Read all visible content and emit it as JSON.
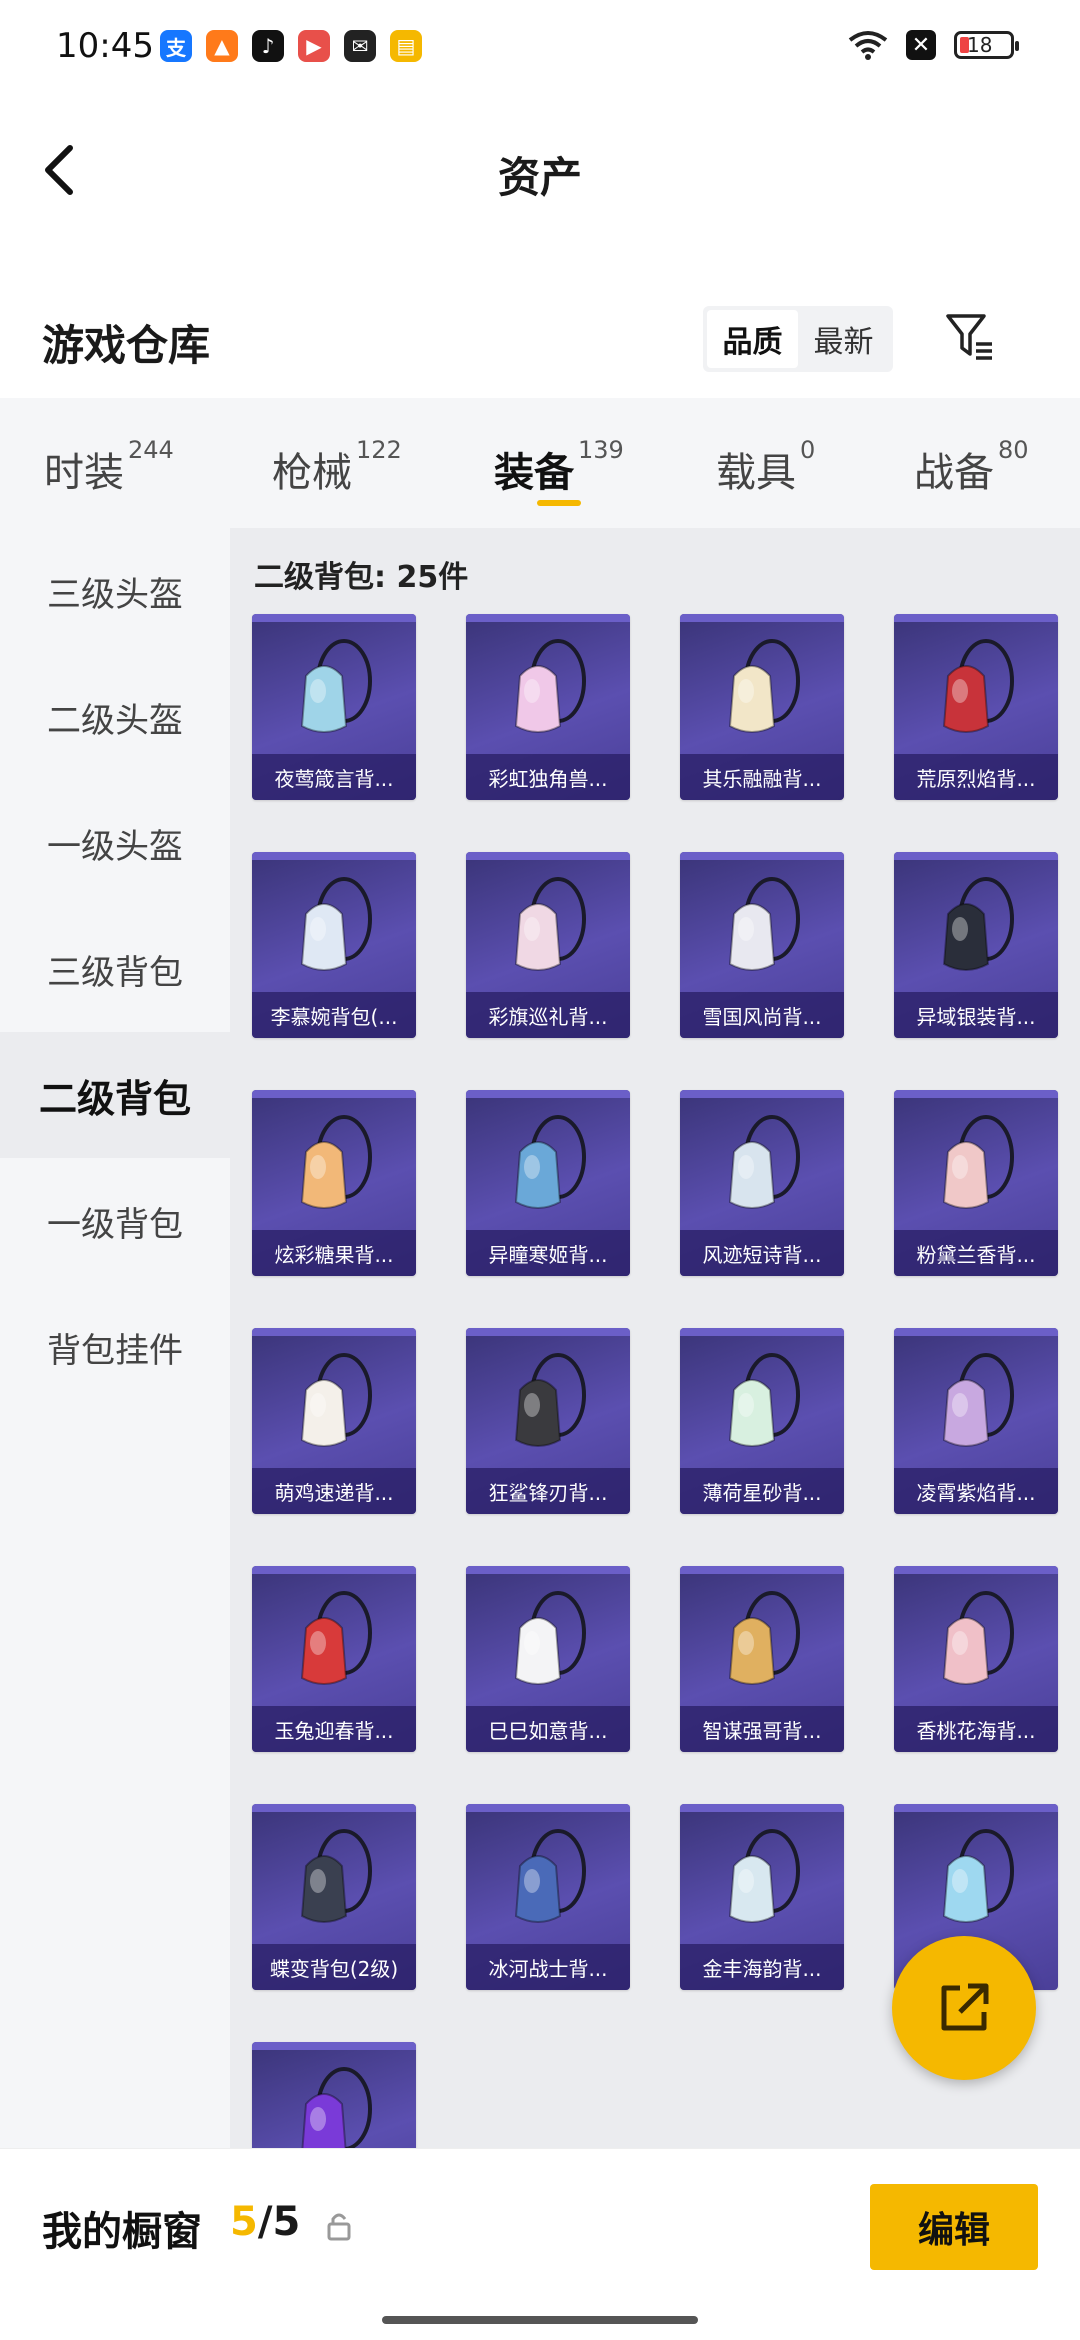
{
  "status": {
    "time": "10:45",
    "battery": "18",
    "battery_level": 0.18,
    "app_icons": [
      {
        "name": "alipay-icon",
        "glyph": "支",
        "color": "#1677ff"
      },
      {
        "name": "map-app-icon",
        "glyph": "▲",
        "color": "#ff7a1a"
      },
      {
        "name": "tiktok-icon",
        "glyph": "♪",
        "color": "#111111"
      },
      {
        "name": "video-app-icon",
        "glyph": "▶",
        "color": "#e8504a"
      },
      {
        "name": "wechat-icon",
        "glyph": "✉",
        "color": "#222222"
      },
      {
        "name": "reader-app-icon",
        "glyph": "▤",
        "color": "#f5b800"
      }
    ]
  },
  "header": {
    "title": "资产"
  },
  "section": {
    "title": "游戏仓库",
    "sort_options": [
      "品质",
      "最新"
    ],
    "active_sort": 0
  },
  "categories": [
    {
      "label": "时装",
      "count": "244"
    },
    {
      "label": "枪械",
      "count": "122"
    },
    {
      "label": "装备",
      "count": "139"
    },
    {
      "label": "载具",
      "count": "0"
    },
    {
      "label": "战备",
      "count": "80"
    }
  ],
  "active_category": 2,
  "sidebar": {
    "items": [
      "三级头盔",
      "二级头盔",
      "一级头盔",
      "三级背包",
      "二级背包",
      "一级背包",
      "背包挂件"
    ],
    "active": 4
  },
  "content": {
    "group_title": "二级背包: 25件",
    "items": [
      {
        "name": "夜莺箴言背...",
        "color": "#9fd4e8"
      },
      {
        "name": "彩虹独角兽...",
        "color": "#f0c8e8"
      },
      {
        "name": "其乐融融背...",
        "color": "#f2e6c8"
      },
      {
        "name": "荒原烈焰背...",
        "color": "#c8333a"
      },
      {
        "name": "李慕婉背包(...",
        "color": "#dfe8f4"
      },
      {
        "name": "彩旗巡礼背...",
        "color": "#f0d8e4"
      },
      {
        "name": "雪国风尚背...",
        "color": "#e8e8f0"
      },
      {
        "name": "异域银装背...",
        "color": "#2a2e3a"
      },
      {
        "name": "炫彩糖果背...",
        "color": "#f2b878"
      },
      {
        "name": "异瞳寒姬背...",
        "color": "#6aa8d8"
      },
      {
        "name": "风迹短诗背...",
        "color": "#d8e4ee"
      },
      {
        "name": "粉黛兰香背...",
        "color": "#f0c8c8"
      },
      {
        "name": "萌鸡速递背...",
        "color": "#f4f0ea"
      },
      {
        "name": "狂鲨锋刃背...",
        "color": "#3a3a3e"
      },
      {
        "name": "薄荷星砂背...",
        "color": "#d8f0e0"
      },
      {
        "name": "凌霄紫焰背...",
        "color": "#c8a8e0"
      },
      {
        "name": "玉兔迎春背...",
        "color": "#d83a3a"
      },
      {
        "name": "巳巳如意背...",
        "color": "#f4f4f6"
      },
      {
        "name": "智谋强哥背...",
        "color": "#e0b060"
      },
      {
        "name": "香桃花海背...",
        "color": "#f0c0c8"
      },
      {
        "name": "蝶变背包(2级)",
        "color": "#3a4050"
      },
      {
        "name": "冰河战士背...",
        "color": "#4a6ab8"
      },
      {
        "name": "金丰海韵背...",
        "color": "#d8e8f0"
      },
      {
        "name": "",
        "color": "#9ed8f0"
      },
      {
        "name": "",
        "color": "#7a3ad8"
      }
    ]
  },
  "showcase": {
    "label": "我的橱窗",
    "current": "5",
    "separator": "/",
    "total": "5",
    "edit_label": "编辑"
  },
  "colors": {
    "accent": "#f5b800",
    "card_bg": "#4a3f98"
  }
}
